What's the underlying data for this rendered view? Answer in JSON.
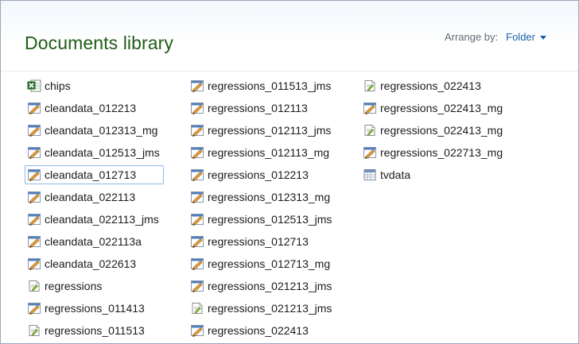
{
  "header": {
    "title": "Documents library",
    "arrange_label": "Arrange by:",
    "arrange_value": "Folder"
  },
  "files": {
    "col1": [
      {
        "name": "chips",
        "icon": "excel-icon"
      },
      {
        "name": "cleandata_012213",
        "icon": "stata-do-file-icon"
      },
      {
        "name": "cleandata_012313_mg",
        "icon": "stata-do-file-icon"
      },
      {
        "name": "cleandata_012513_jms",
        "icon": "stata-do-file-icon"
      },
      {
        "name": "cleandata_012713",
        "icon": "stata-do-file-icon",
        "focused": true
      },
      {
        "name": "cleandata_022113",
        "icon": "stata-do-file-icon"
      },
      {
        "name": "cleandata_022113_jms",
        "icon": "stata-do-file-icon"
      },
      {
        "name": "cleandata_022113a",
        "icon": "stata-do-file-icon"
      },
      {
        "name": "cleandata_022613",
        "icon": "stata-do-file-icon"
      },
      {
        "name": "regressions",
        "icon": "stata-log-file-icon"
      },
      {
        "name": "regressions_011413",
        "icon": "stata-do-file-icon"
      },
      {
        "name": "regressions_011513",
        "icon": "stata-log-file-icon"
      }
    ],
    "col2": [
      {
        "name": "regressions_011513_jms",
        "icon": "stata-do-file-icon"
      },
      {
        "name": "regressions_012113",
        "icon": "stata-do-file-icon"
      },
      {
        "name": "regressions_012113_jms",
        "icon": "stata-do-file-icon"
      },
      {
        "name": "regressions_012113_mg",
        "icon": "stata-do-file-icon"
      },
      {
        "name": "regressions_012213",
        "icon": "stata-do-file-icon"
      },
      {
        "name": "regressions_012313_mg",
        "icon": "stata-do-file-icon"
      },
      {
        "name": "regressions_012513_jms",
        "icon": "stata-do-file-icon"
      },
      {
        "name": "regressions_012713",
        "icon": "stata-do-file-icon"
      },
      {
        "name": "regressions_012713_mg",
        "icon": "stata-do-file-icon"
      },
      {
        "name": "regressions_021213_jms",
        "icon": "stata-do-file-icon"
      },
      {
        "name": "regressions_021213_jms",
        "icon": "stata-log-file-icon"
      },
      {
        "name": "regressions_022413",
        "icon": "stata-do-file-icon"
      }
    ],
    "col3": [
      {
        "name": "regressions_022413",
        "icon": "stata-log-file-icon"
      },
      {
        "name": "regressions_022413_mg",
        "icon": "stata-do-file-icon"
      },
      {
        "name": "regressions_022413_mg",
        "icon": "stata-log-file-icon"
      },
      {
        "name": "regressions_022713_mg",
        "icon": "stata-do-file-icon"
      },
      {
        "name": "tvdata",
        "icon": "stata-data-file-icon"
      }
    ]
  },
  "colors": {
    "title": "#1e5c17",
    "link": "#1a5fb0",
    "focus_border": "#8fb8e6"
  }
}
